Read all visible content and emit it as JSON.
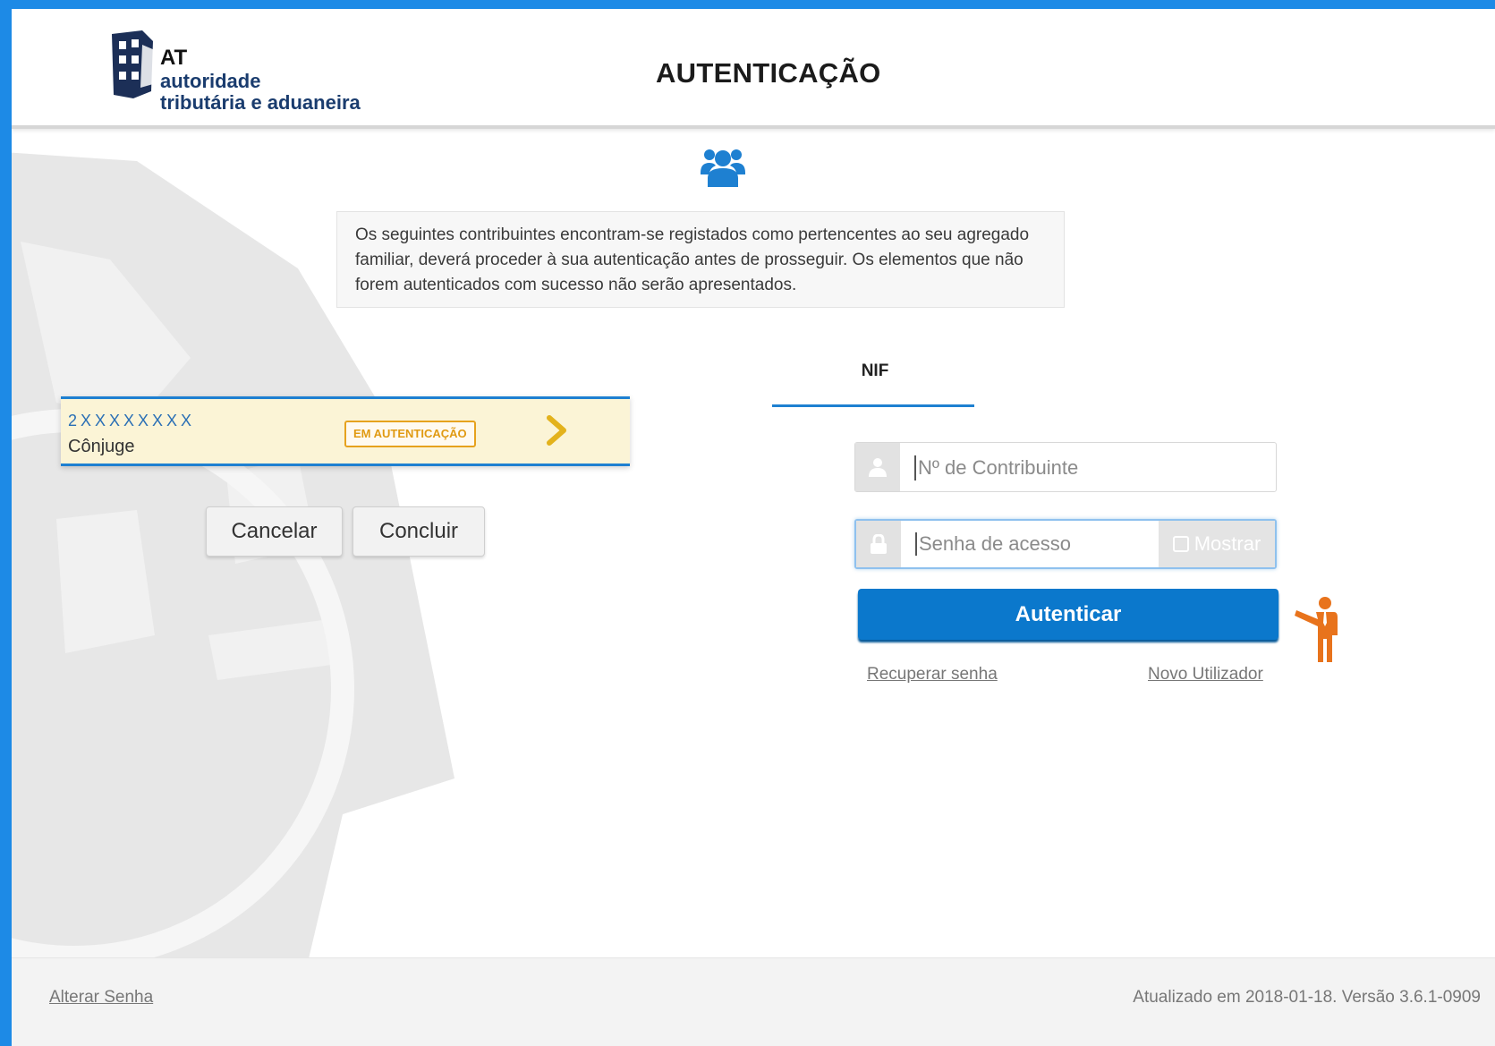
{
  "header": {
    "logo_abbrev": "AT",
    "logo_line2": "autoridade",
    "logo_line3": "tributária e aduaneira",
    "title": "AUTENTICAÇÃO"
  },
  "main": {
    "group_icon": "users-group-icon",
    "notice": "Os seguintes contribuintes encontram-se registados como pertencentes ao seu agregado familiar, deverá proceder à sua autenticação antes de prosseguir. Os elementos que não forem autenticados com sucesso não serão apresentados.",
    "member": {
      "nif": "2XXXXXXXX",
      "role": "Cônjuge",
      "status": "EM AUTENTICAÇÃO"
    },
    "cancel_label": "Cancelar",
    "conclude_label": "Concluir"
  },
  "login": {
    "tab_label": "NIF",
    "nif_placeholder": "Nº de Contribuinte",
    "password_placeholder": "Senha de acesso",
    "show_label": "Mostrar",
    "submit_label": "Autenticar",
    "recover_label": "Recuperar senha",
    "new_user_label": "Novo Utilizador"
  },
  "footer": {
    "change_password_label": "Alterar Senha",
    "version_text": "Atualizado em 2018-01-18. Versão 3.6.1-0909"
  },
  "colors": {
    "primary_blue": "#0b78cc",
    "frame_blue": "#1d8ae6",
    "status_amber": "#e6a21e",
    "card_bg": "#fbf4d6",
    "guide_orange": "#e8731c"
  }
}
